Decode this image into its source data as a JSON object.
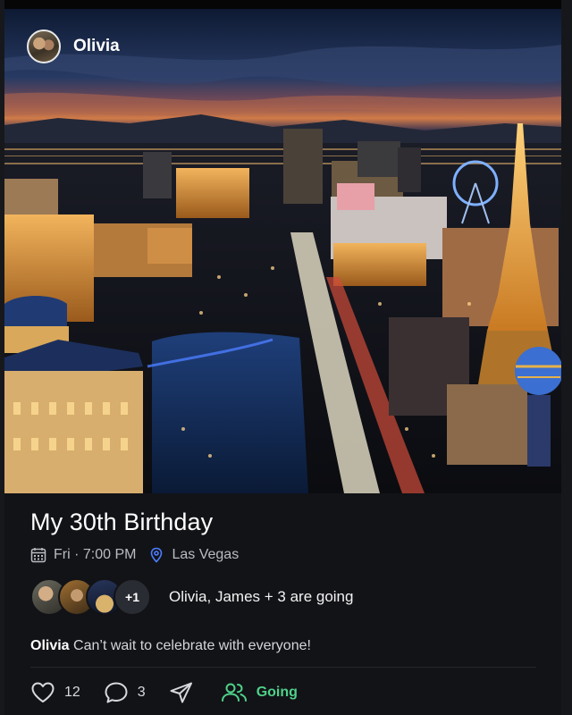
{
  "post": {
    "author": "Olivia",
    "title": "My 30th Birthday",
    "when": "Fri · 7:00 PM",
    "where": "Las Vegas",
    "attendees_more": "+1",
    "going_text": "Olivia, James + 3 are going",
    "comment": {
      "author": "Olivia",
      "text": "Can’t wait to celebrate with everyone!"
    },
    "likes": "12",
    "comments": "3",
    "rsvp_label": "Going"
  },
  "colors": {
    "background": "#0d0e12",
    "card": "#121317",
    "going_accent": "#4fd189",
    "location_pin": "#4d7dff"
  },
  "icons": [
    "calendar-icon",
    "location-pin-icon",
    "heart-icon",
    "comment-icon",
    "send-icon",
    "people-icon"
  ]
}
